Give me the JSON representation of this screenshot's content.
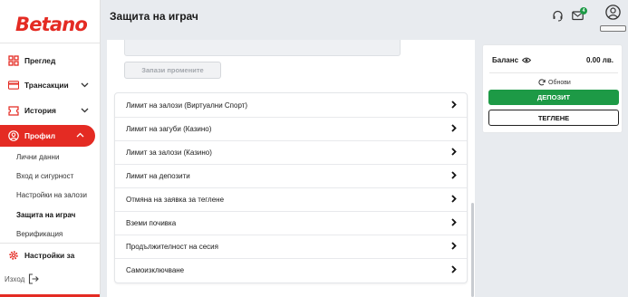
{
  "brand": {
    "logo_text": "Betano",
    "accent": "#e42b23",
    "success": "#1d9a46"
  },
  "header": {
    "title": "Защита на играч",
    "notification_count": "4"
  },
  "sidebar": {
    "items": [
      {
        "label": "Преглед",
        "icon": "grid-icon"
      },
      {
        "label": "Трансакции",
        "icon": "card-icon"
      },
      {
        "label": "История",
        "icon": "ticket-icon"
      },
      {
        "label": "Профил",
        "icon": "user-icon"
      },
      {
        "label": "Настройки за",
        "icon": "gear-icon"
      }
    ],
    "sub_items": [
      {
        "label": "Лични данни"
      },
      {
        "label": "Вход и сигурност"
      },
      {
        "label": "Настройки на залози"
      },
      {
        "label": "Защита на играч"
      },
      {
        "label": "Верификация"
      }
    ],
    "logout_label": "Изход"
  },
  "main": {
    "save_label": "Запази промените",
    "limits": [
      {
        "label": "Лимит на залози (Виртуални Спорт)"
      },
      {
        "label": "Лимит на загуби (Казино)"
      },
      {
        "label": "Лимит за залози (Казино)"
      },
      {
        "label": "Лимит на депозити"
      },
      {
        "label": "Отмяна на заявка за теглене"
      },
      {
        "label": "Вземи почивка"
      },
      {
        "label": "Продължителност на сесия"
      },
      {
        "label": "Самоизключване"
      }
    ]
  },
  "balance": {
    "label": "Баланс",
    "value": "0.00 лв.",
    "refresh_label": "Обнови",
    "deposit_label": "ДЕПОЗИТ",
    "withdraw_label": "ТЕГЛЕНЕ"
  }
}
